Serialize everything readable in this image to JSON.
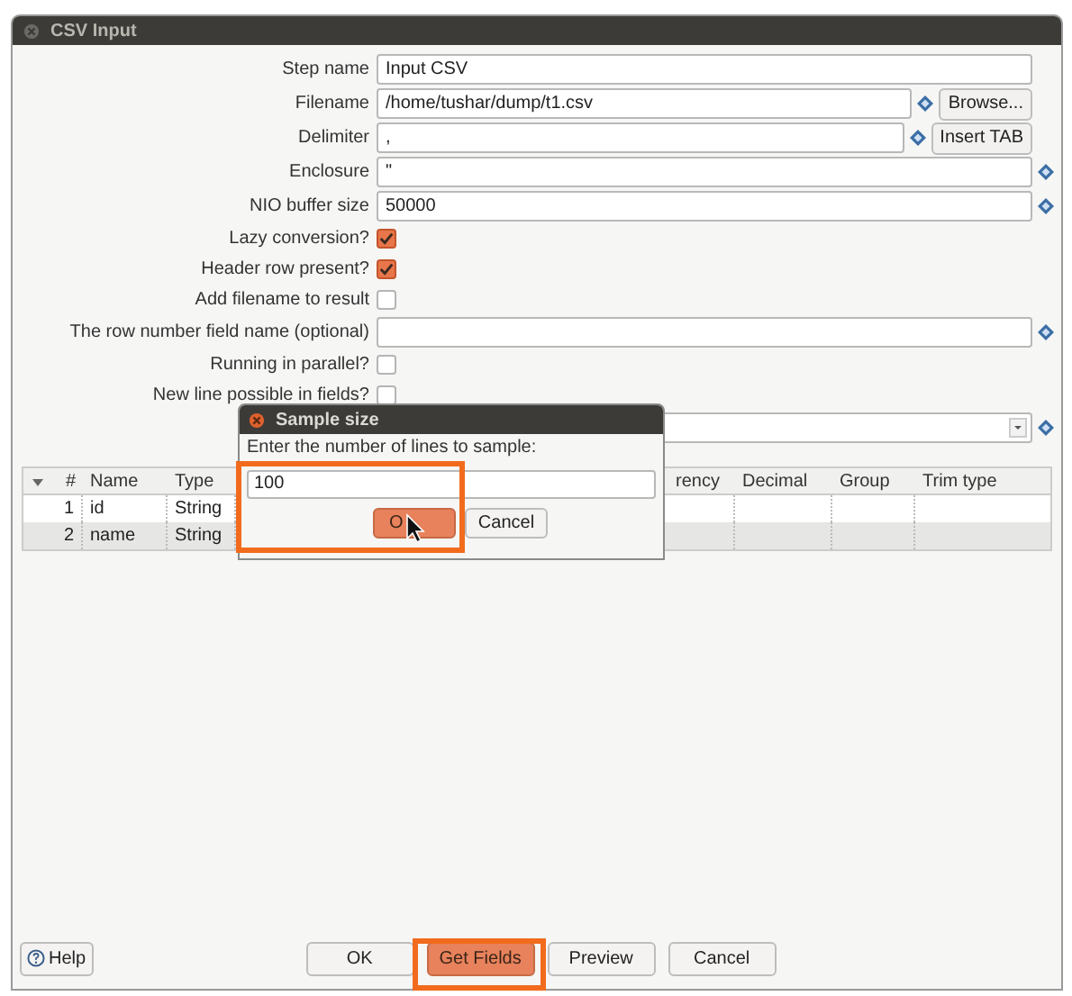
{
  "window": {
    "title": "CSV Input"
  },
  "form": [
    {
      "kind": "text",
      "label": "Step name",
      "value": "Input CSV"
    },
    {
      "kind": "button",
      "label": "Filename",
      "value": "/home/tushar/dump/t1.csv",
      "button": "Browse..."
    },
    {
      "kind": "button",
      "label": "Delimiter",
      "value": ",",
      "button": "Insert TAB"
    },
    {
      "kind": "var",
      "label": "Enclosure",
      "value": "\""
    },
    {
      "kind": "var",
      "label": "NIO buffer size",
      "value": "50000"
    },
    {
      "kind": "check",
      "label": "Lazy conversion?",
      "checked": true
    },
    {
      "kind": "check",
      "label": "Header row present?",
      "checked": true
    },
    {
      "kind": "check",
      "label": "Add filename to result",
      "checked": false
    },
    {
      "kind": "var",
      "label": "The row number field name (optional)"
    },
    {
      "kind": "check",
      "label": "Running in parallel?",
      "checked": false
    },
    {
      "kind": "check",
      "label": "New line possible in fields?",
      "checked": false
    },
    {
      "kind": "combo"
    }
  ],
  "table": {
    "columns": [
      "#",
      "Name",
      "Type",
      "rency",
      "Decimal",
      "Group",
      "Trim type"
    ],
    "rows": [
      {
        "n": "1",
        "name": "id",
        "type": "String"
      },
      {
        "n": "2",
        "name": "name",
        "type": "String"
      }
    ]
  },
  "dialog": {
    "title": "Sample size",
    "prompt": "Enter the number of lines to sample:",
    "value": "100",
    "buttons": [
      "O",
      "Cancel"
    ]
  },
  "buttons": [
    {
      "label": "Help",
      "kind": "help",
      "highlighted": false
    },
    {
      "label": "OK",
      "kind": "plain",
      "highlighted": false
    },
    {
      "label": "Get Fields",
      "kind": "plain",
      "highlighted": true
    },
    {
      "label": "Preview",
      "kind": "plain",
      "highlighted": false
    },
    {
      "label": "Cancel",
      "kind": "plain",
      "highlighted": false
    }
  ]
}
